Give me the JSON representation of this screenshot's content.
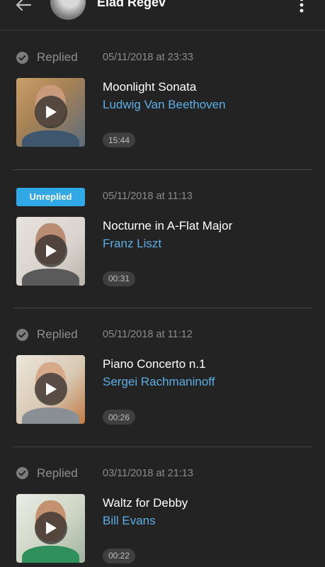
{
  "header": {
    "title": "Elad Regev",
    "back_icon": "arrow-left-icon",
    "more_icon": "more-vertical-icon"
  },
  "colors": {
    "background": "#232323",
    "accent_link": "#5eaee6",
    "unreplied_badge": "#31a9e6",
    "muted_text": "#8c8c8c"
  },
  "entries": [
    {
      "status": "Replied",
      "status_type": "replied",
      "timestamp": "05/11/2018 at 23:33",
      "title": "Moonlight Sonata",
      "composer": "Ludwig Van Beethoven",
      "duration": "15:44"
    },
    {
      "status": "Unreplied",
      "status_type": "unreplied",
      "timestamp": "05/11/2018 at 11:13",
      "title": "Nocturne in A-Flat Major",
      "composer": "Franz Liszt",
      "duration": "00:31"
    },
    {
      "status": "Replied",
      "status_type": "replied",
      "timestamp": "05/11/2018 at 11:12",
      "title": "Piano Concerto n.1",
      "composer": "Sergei Rachmaninoff",
      "duration": "00:26"
    },
    {
      "status": "Replied",
      "status_type": "replied",
      "timestamp": "03/11/2018 at 21:13",
      "title": "Waltz for Debby",
      "composer": "Bill Evans",
      "duration": "00:22"
    }
  ]
}
